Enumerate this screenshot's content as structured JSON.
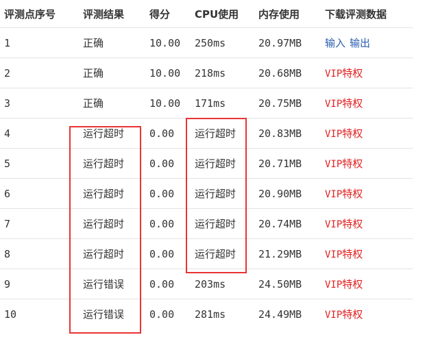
{
  "headers": {
    "index": "评测点序号",
    "result": "评测结果",
    "score": "得分",
    "cpu": "CPU使用",
    "memory": "内存使用",
    "download": "下载评测数据"
  },
  "rows": [
    {
      "index": "1",
      "result": "正确",
      "score": "10.00",
      "cpu": "250ms",
      "memory": "20.97MB",
      "download": {
        "type": "io",
        "input": "输入",
        "output": "输出"
      }
    },
    {
      "index": "2",
      "result": "正确",
      "score": "10.00",
      "cpu": "218ms",
      "memory": "20.68MB",
      "download": {
        "type": "vip",
        "prefix": "VIP",
        "suffix": "特权"
      }
    },
    {
      "index": "3",
      "result": "正确",
      "score": "10.00",
      "cpu": "171ms",
      "memory": "20.75MB",
      "download": {
        "type": "vip",
        "prefix": "VIP",
        "suffix": "特权"
      }
    },
    {
      "index": "4",
      "result": "运行超时",
      "score": "0.00",
      "cpu": "运行超时",
      "memory": "20.83MB",
      "download": {
        "type": "vip",
        "prefix": "VIP",
        "suffix": "特权"
      }
    },
    {
      "index": "5",
      "result": "运行超时",
      "score": "0.00",
      "cpu": "运行超时",
      "memory": "20.71MB",
      "download": {
        "type": "vip",
        "prefix": "VIP",
        "suffix": "特权"
      }
    },
    {
      "index": "6",
      "result": "运行超时",
      "score": "0.00",
      "cpu": "运行超时",
      "memory": "20.90MB",
      "download": {
        "type": "vip",
        "prefix": "VIP",
        "suffix": "特权"
      }
    },
    {
      "index": "7",
      "result": "运行超时",
      "score": "0.00",
      "cpu": "运行超时",
      "memory": "20.74MB",
      "download": {
        "type": "vip",
        "prefix": "VIP",
        "suffix": "特权"
      }
    },
    {
      "index": "8",
      "result": "运行超时",
      "score": "0.00",
      "cpu": "运行超时",
      "memory": "21.29MB",
      "download": {
        "type": "vip",
        "prefix": "VIP",
        "suffix": "特权"
      }
    },
    {
      "index": "9",
      "result": "运行错误",
      "score": "0.00",
      "cpu": "203ms",
      "memory": "24.50MB",
      "download": {
        "type": "vip",
        "prefix": "VIP",
        "suffix": "特权"
      }
    },
    {
      "index": "10",
      "result": "运行错误",
      "score": "0.00",
      "cpu": "281ms",
      "memory": "24.49MB",
      "download": {
        "type": "vip",
        "prefix": "VIP",
        "suffix": "特权"
      }
    }
  ],
  "colors": {
    "vip_link": "#e02020",
    "download_link": "#2a5db0",
    "highlight_box": "#e83232",
    "row_border": "#e2e2e2",
    "text": "#333333"
  }
}
